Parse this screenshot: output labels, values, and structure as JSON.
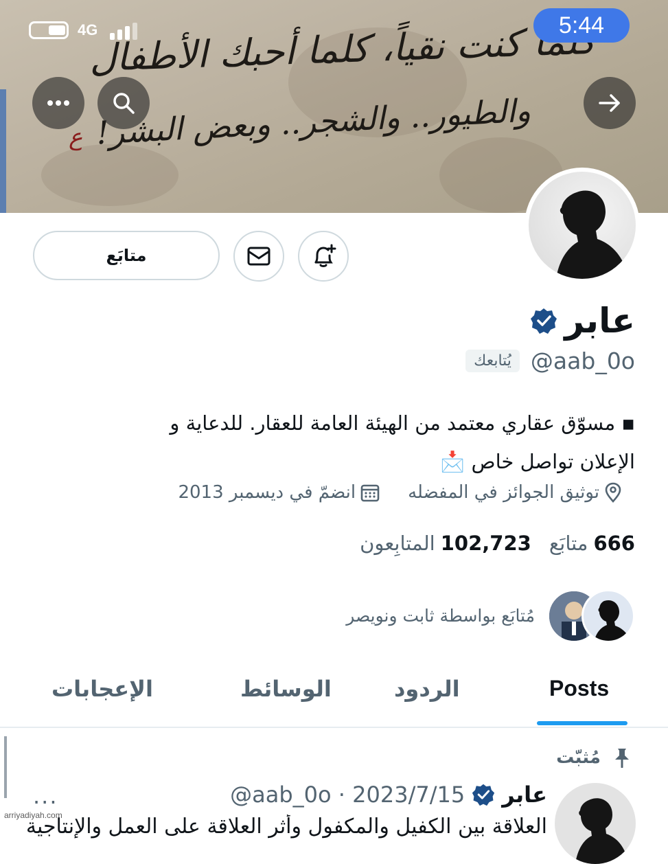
{
  "status_bar": {
    "time": "5:44",
    "network": "4G"
  },
  "banner": {
    "graffiti_line1": "\"كلما كنت نقياً، كلما أحبك الأطفال",
    "graffiti_line2": "والطيور.. والشجر.. وبعض البشر!",
    "graffiti_signature": "ع"
  },
  "profile": {
    "name": "عابر",
    "handle": "@aab_0o",
    "follows_you": "يُتابعك",
    "bio_line1": "▪ مسوّق عقاري معتمد من الهيئة العامة للعقار. للدعاية و",
    "bio_line2": "الإعلان تواصل خاص 📩",
    "location": "توثيق الجوائز في المفضله",
    "joined": "انضمّ في ديسمبر 2013",
    "following_count": "666",
    "following_label": "متابَع",
    "followers_count": "102,723",
    "followers_label": "المتابِعون",
    "followed_by": "مُتابَع بواسطة ثابت ونويصر",
    "follow_button": "متابَع"
  },
  "tabs": [
    {
      "label": "Posts",
      "active": true
    },
    {
      "label": "الردود",
      "active": false
    },
    {
      "label": "الوسائط",
      "active": false
    },
    {
      "label": "الإعجابات",
      "active": false
    }
  ],
  "pinned_post": {
    "pinned_label": "مُثبّت",
    "author": "عابر",
    "handle_date": "@aab_0o · 2023/7/15",
    "more": "...",
    "text": "العلاقة بين الكفيل والمكفول وأثر العلاقة على العمل والإنتاجية"
  },
  "watermark": "arriyadiyah.com",
  "colors": {
    "accent": "#1d9bf0",
    "verified": "#1d9bf0",
    "time_pill": "#3f78e8",
    "secondary_text": "#536471"
  }
}
